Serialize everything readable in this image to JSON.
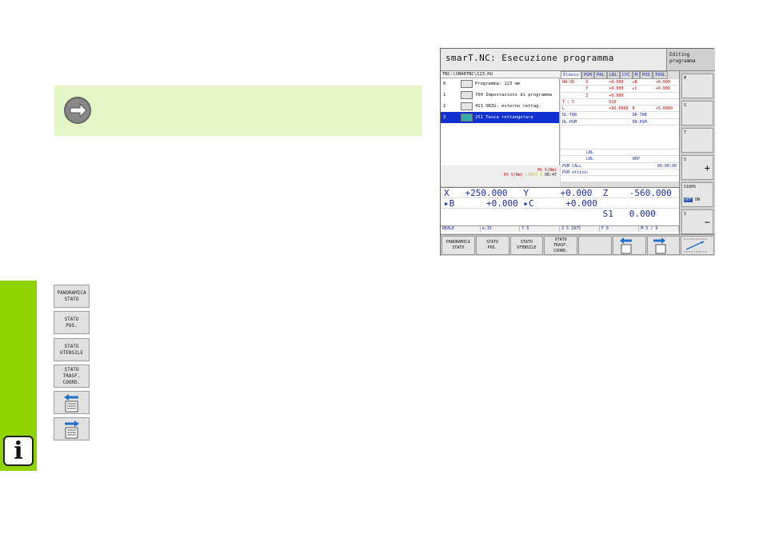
{
  "note": {
    "icon": "arrow-right-icon"
  },
  "sidebar": {
    "info_icon": "i"
  },
  "left_softkeys": [
    {
      "l1": "PANORAMICA",
      "l2": "STATO",
      "l3": ""
    },
    {
      "l1": "STATO",
      "l2": "POS.",
      "l3": ""
    },
    {
      "l1": "STATO",
      "l2": "UTENSILE",
      "l3": ""
    },
    {
      "l1": "STATO",
      "l2": "TRASF.",
      "l3": "COORD."
    }
  ],
  "cnc": {
    "title": "smarT.NC: Esecuzione programma",
    "mode_l1": "Editing",
    "mode_l2": "programma",
    "path": "TNC:\\SMARTNC\\123.HU",
    "tree": [
      {
        "num": "0",
        "label": "Programma: 123 mm"
      },
      {
        "num": "1",
        "label": "700 Impostazioni di programma"
      },
      {
        "num": "2",
        "label": "411 ORIG. esterno rettag."
      },
      {
        "num": "3",
        "label": "251 Tasca rettangolare"
      }
    ],
    "tabs": [
      "Elenco",
      "PGM",
      "PAL",
      "LBL",
      "CYC",
      "M",
      "POS",
      "TOOL"
    ],
    "status_rows": [
      {
        "a": "RW-3D",
        "b": "X",
        "c": "+0.000",
        "d": "▸B",
        "e": "+0.000"
      },
      {
        "a": "",
        "b": "Y",
        "c": "+0.000",
        "d": "▸C",
        "e": "+0.000"
      },
      {
        "a": "",
        "b": "Z",
        "c": "+0.000",
        "d": "",
        "e": ""
      },
      {
        "a": "T : 5",
        "b": "",
        "c": "D10",
        "d": "",
        "e": ""
      },
      {
        "a": "L",
        "b": "",
        "c": "+60.0000",
        "d": "R",
        "e": "+5.0000"
      },
      {
        "a": "DL-TAB",
        "b": "",
        "c": "",
        "d": "DR-TAB",
        "e": ""
      },
      {
        "a": "DL-PGM",
        "b": "",
        "c": "",
        "d": "DR-PGM",
        "e": ""
      }
    ],
    "lbl1": "LBL",
    "lbl2": "LBL",
    "rep": "REP",
    "pgm_call": "PGM CALL",
    "timer": "00:00:00",
    "pgm_active": "PGM attivo:",
    "prog_info1": "0% S(Nm)",
    "prog_info2": "0% S(Nm)",
    "limit": "LIMIT 1",
    "clock": "08:47",
    "positions": [
      [
        "X   +250.000",
        "Y      +0.000",
        "Z    -560.000"
      ],
      [
        "▸B      +0.000",
        "▸C      +0.000",
        ""
      ],
      [
        "",
        "",
        "S1   0.000"
      ]
    ],
    "stat_bar": [
      "REALE",
      "⊕:15",
      "T 5",
      "Z S 1875",
      "F 0",
      "M 5 / 9"
    ],
    "right_softkeys": [
      "M",
      "S",
      "T",
      "S",
      "S100%",
      "S"
    ],
    "ovr_off": "OFF",
    "ovr_on": "ON",
    "softkeys": [
      {
        "l1": "PANORAMICA",
        "l2": "STATO",
        "l3": ""
      },
      {
        "l1": "STATO",
        "l2": "POS.",
        "l3": ""
      },
      {
        "l1": "STATO",
        "l2": "UTENSILE",
        "l3": ""
      },
      {
        "l1": "STATO",
        "l2": "TRASF.",
        "l3": "COORD."
      }
    ]
  }
}
